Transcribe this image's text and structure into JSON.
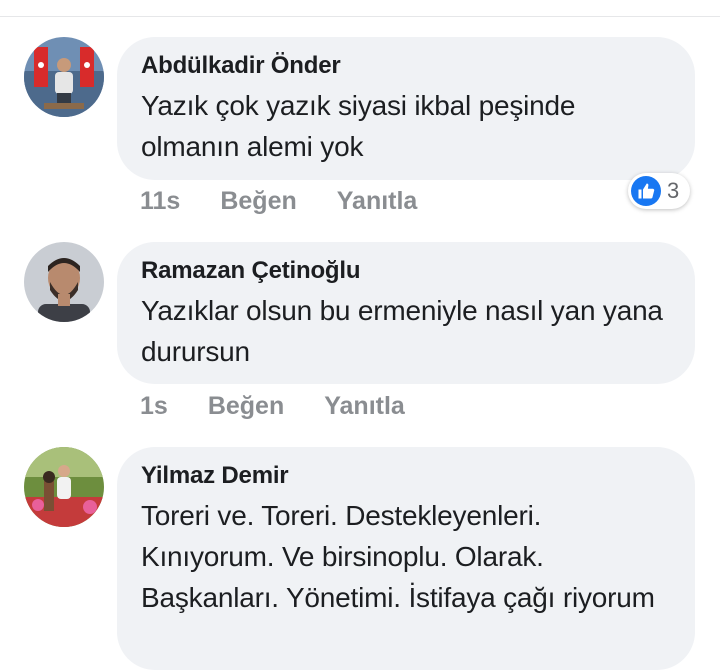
{
  "comments": [
    {
      "author": "Abdülkadir Önder",
      "text": "Yazık çok yazık siyasi ikbal peşinde olmanın alemi yok",
      "time": "11s",
      "like_label": "Beğen",
      "reply_label": "Yanıtla",
      "reaction_count": "3",
      "reaction_icon": "like-icon"
    },
    {
      "author": "Ramazan Çetinoğlu",
      "text": "Yazıklar olsun bu ermeniyle nasıl yan yana durursun",
      "time": "1s",
      "like_label": "Beğen",
      "reply_label": "Yanıtla"
    },
    {
      "author": "Yilmaz Demir",
      "text": "Toreri ve. Toreri. Destekleyenleri. Kınıyorum. Ve birsinoplu. Olarak. Başkanları. Yönetimi. İstifaya çağı riyorum"
    }
  ],
  "colors": {
    "bubble": "#f0f2f5",
    "meta_text": "#8a8d91",
    "like_blue": "#1877f2"
  }
}
